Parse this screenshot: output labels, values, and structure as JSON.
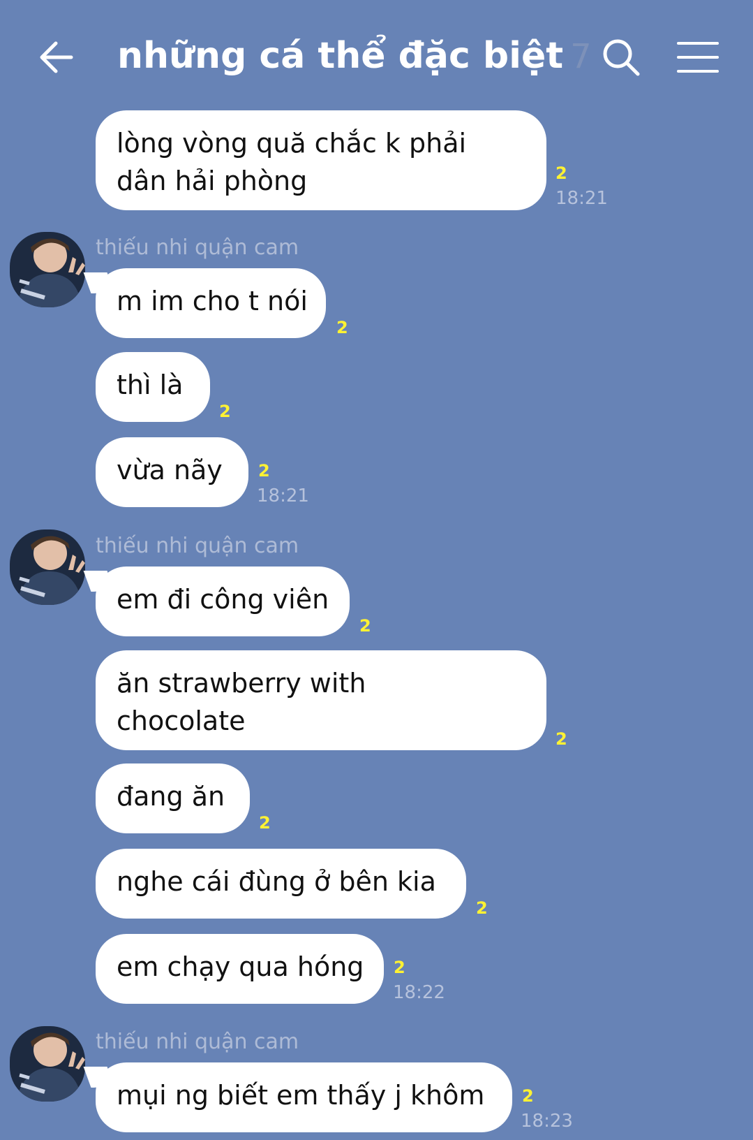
{
  "header": {
    "title": "những cá thể đặc biệt",
    "member_count": "7",
    "back_icon": "back-arrow-icon",
    "search_icon": "search-icon",
    "menu_icon": "menu-icon"
  },
  "colors": {
    "background": "#6783b6",
    "bubble": "#ffffff",
    "read_count": "#fff233",
    "sender_name": "#aebbd6",
    "time": "#b6c2dc"
  },
  "messages": [
    {
      "text_line1": "lòng vòng quă chắc k phải",
      "text_line2": "dân hải phòng",
      "read_count": "2",
      "time": "18:21"
    },
    {
      "sender": "thiếu nhi quận cam",
      "text": "m im cho t nói",
      "read_count": "2"
    },
    {
      "text": "thì là",
      "read_count": "2"
    },
    {
      "text": "vừa nãy",
      "read_count": "2",
      "time": "18:21"
    },
    {
      "sender": "thiếu nhi quận cam",
      "text": "em đi công viên",
      "read_count": "2"
    },
    {
      "text_line1": "ăn strawberry with",
      "text_line2": "chocolate",
      "read_count": "2"
    },
    {
      "text": "đang ăn",
      "read_count": "2"
    },
    {
      "text": "nghe cái đùng ở bên kia",
      "read_count": "2"
    },
    {
      "text": "em chạy qua hóng",
      "read_count": "2",
      "time": "18:22"
    },
    {
      "sender": "thiếu nhi quận cam",
      "text": "mụi ng biết em thấy j khôm",
      "read_count": "2",
      "time": "18:23"
    }
  ]
}
